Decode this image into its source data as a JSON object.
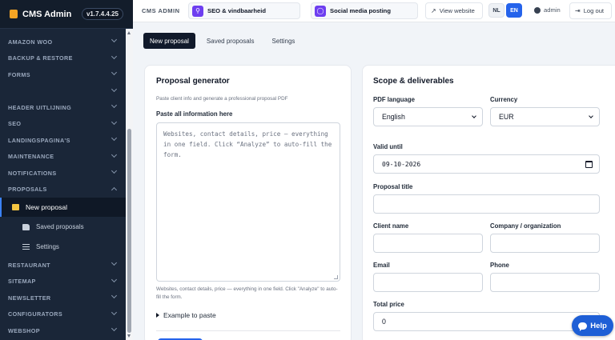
{
  "sidebar": {
    "brand": "CMS Admin",
    "version": "v1.7.4.4.25",
    "items": [
      {
        "label": "AMAZON WOO",
        "chevron": "down"
      },
      {
        "label": "BACKUP & RESTORE",
        "chevron": "down"
      },
      {
        "label": "FORMS",
        "chevron": "down"
      },
      {
        "label": "",
        "chevron": ""
      },
      {
        "label": "HEADER UITLIJNING",
        "chevron": "down"
      },
      {
        "label": "SEO",
        "chevron": "down"
      },
      {
        "label": "LANDINGSPAGINA'S",
        "chevron": "down"
      },
      {
        "label": "MAINTENANCE",
        "chevron": "down"
      },
      {
        "label": "NOTIFICATIONS",
        "chevron": "down"
      },
      {
        "label": "PROPOSALS",
        "chevron": "up"
      }
    ],
    "proposals_sub": {
      "active": {
        "label": "New proposal",
        "icon": "document-edit-icon"
      },
      "items": [
        {
          "label": "Saved proposals",
          "icon": "folder-open-icon"
        },
        {
          "label": "Settings",
          "icon": "sliders-icon"
        }
      ]
    },
    "items_after": [
      {
        "label": "RESTAURANT"
      },
      {
        "label": "SITEMAP"
      },
      {
        "label": "NEWSLETTER"
      },
      {
        "label": "CONFIGURATORS"
      },
      {
        "label": "WEBSHOP"
      }
    ]
  },
  "topbar": {
    "cms_label": "CMS ADMIN",
    "seo_button": "SEO & vindbaarheid",
    "social_button": "Social media posting",
    "view_website": "View website",
    "lang_nl": "NL",
    "lang_en": "EN",
    "active_lang": "EN",
    "user": "admin",
    "logout": "Log out"
  },
  "tabs": {
    "new_proposal": "New proposal",
    "saved_proposals": "Saved proposals",
    "settings": "Settings",
    "active": "New proposal"
  },
  "generator": {
    "title": "Proposal generator",
    "subtitle": "Paste client info and generate a professional proposal PDF",
    "paste_label": "Paste all information here",
    "paste_placeholder": "Websites, contact details, price — everything in one field. Click “Analyze” to auto-fill the form.",
    "help_text": "Websites, contact details, price — everything in one field. Click \"Analyze\" to auto-fill the form.",
    "example_toggle": "Example to paste"
  },
  "scope": {
    "title": "Scope & deliverables",
    "pdf_language_label": "PDF language",
    "pdf_language_value": "English",
    "currency_label": "Currency",
    "currency_value": "EUR",
    "valid_until_label": "Valid until",
    "valid_until_value": "09-10-2026",
    "proposal_title_label": "Proposal title",
    "proposal_title_value": "",
    "client_name_label": "Client name",
    "client_name_value": "",
    "company_label": "Company / organization",
    "company_value": "",
    "email_label": "Email",
    "email_value": "",
    "phone_label": "Phone",
    "phone_value": "",
    "total_price_label": "Total price",
    "total_price_value": "0"
  },
  "help_button": "Help",
  "colors": {
    "sidebar_bg": "#1a2638",
    "accent": "#2563eb",
    "brand_icon": "#f5a524",
    "tab_active": "#111a2b"
  }
}
